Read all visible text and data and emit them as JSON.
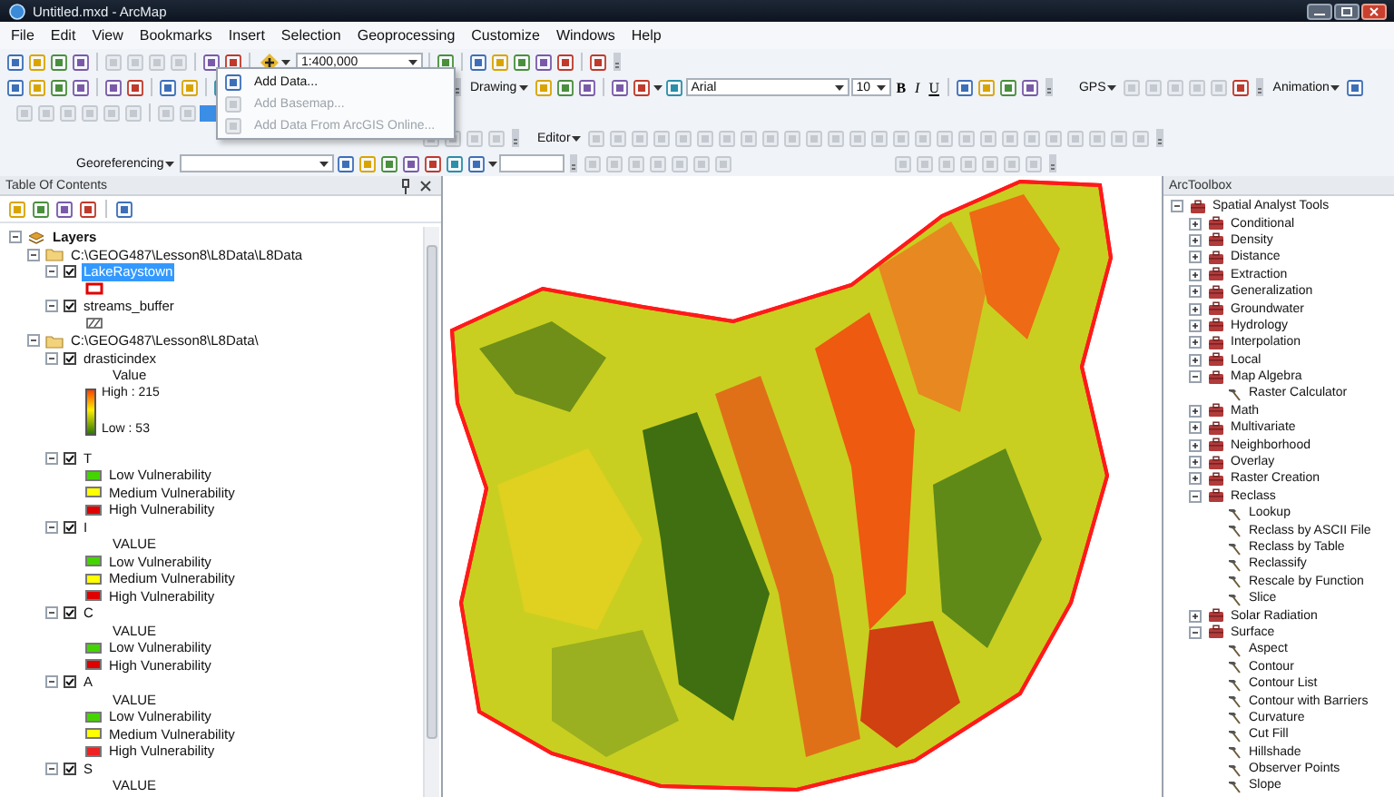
{
  "window": {
    "title": "Untitled.mxd - ArcMap"
  },
  "menu": [
    "File",
    "Edit",
    "View",
    "Bookmarks",
    "Insert",
    "Selection",
    "Geoprocessing",
    "Customize",
    "Windows",
    "Help"
  ],
  "toolbar": {
    "scale": "1:400,000",
    "drawing": "Drawing",
    "font": "Arial",
    "font_size": "10",
    "bold": "B",
    "italic": "I",
    "underline": "U",
    "gps": "GPS",
    "animation": "Animation",
    "editor": "Editor",
    "georeferencing": "Georeferencing"
  },
  "add_data_menu": [
    {
      "label": "Add Data...",
      "disabled": false
    },
    {
      "label": "Add Basemap...",
      "disabled": true
    },
    {
      "label": "Add Data From ArcGIS Online...",
      "disabled": true
    }
  ],
  "toc": {
    "title": "Table Of Contents",
    "root": {
      "label": "Layers",
      "expanded": true,
      "children": [
        {
          "label": "C:\\GEOG487\\Lesson8\\L8Data\\L8Data",
          "expanded": true,
          "children": [
            {
              "name": "LakeRaystown",
              "checked": true,
              "selected": true,
              "expanded": true,
              "legend": [
                {
                  "kind": "outline",
                  "color": "#e00000"
                }
              ]
            },
            {
              "name": "streams_buffer",
              "checked": true,
              "selected": false,
              "expanded": true,
              "legend": [
                {
                  "kind": "hatch"
                }
              ]
            }
          ]
        },
        {
          "label": "C:\\GEOG487\\Lesson8\\L8Data\\",
          "expanded": true,
          "children": [
            {
              "name": "drasticindex",
              "checked": true,
              "selected": false,
              "expanded": true,
              "heading": "Value",
              "ramp": {
                "high": "High : 215",
                "low": "Low : 53"
              }
            },
            {
              "name": "T",
              "checked": true,
              "selected": false,
              "expanded": true,
              "legend": [
                {
                  "kind": "fill",
                  "label": "Low Vulnerability",
                  "color": "#44d400"
                },
                {
                  "kind": "fill",
                  "label": "Medium Vulnerability",
                  "color": "#ffff00"
                },
                {
                  "kind": "fill",
                  "label": "High Vulnerability",
                  "color": "#e00000"
                }
              ]
            },
            {
              "name": "I",
              "checked": true,
              "selected": false,
              "expanded": true,
              "heading": "VALUE",
              "legend": [
                {
                  "kind": "fill",
                  "label": "Low Vulnerability",
                  "color": "#44d400"
                },
                {
                  "kind": "fill",
                  "label": "Medium Vulnerability",
                  "color": "#ffff00"
                },
                {
                  "kind": "fill",
                  "label": "High Vulnerability",
                  "color": "#e00000"
                }
              ]
            },
            {
              "name": "C",
              "checked": true,
              "selected": false,
              "expanded": true,
              "heading": "VALUE",
              "legend": [
                {
                  "kind": "fill",
                  "label": "Low Vulnerability",
                  "color": "#44d400"
                },
                {
                  "kind": "fill",
                  "label": "High Vunerability",
                  "color": "#e00000"
                }
              ]
            },
            {
              "name": "A",
              "checked": true,
              "selected": false,
              "expanded": true,
              "heading": "VALUE",
              "legend": [
                {
                  "kind": "fill",
                  "label": "Low Vulnerability",
                  "color": "#44d400"
                },
                {
                  "kind": "fill",
                  "label": "Medium Vulnerability",
                  "color": "#ffff00"
                },
                {
                  "kind": "fill",
                  "label": "High Vulnerability",
                  "color": "#ee2222"
                }
              ]
            },
            {
              "name": "S",
              "checked": true,
              "selected": false,
              "expanded": true,
              "heading": "VALUE"
            }
          ]
        }
      ]
    }
  },
  "toolbox": {
    "title": "ArcToolbox",
    "items": [
      {
        "label": "Spatial Analyst Tools",
        "kind": "toolbox",
        "expanded": true,
        "children": [
          {
            "label": "Conditional",
            "kind": "toolset",
            "expanded": false
          },
          {
            "label": "Density",
            "kind": "toolset",
            "expanded": false
          },
          {
            "label": "Distance",
            "kind": "toolset",
            "expanded": false
          },
          {
            "label": "Extraction",
            "kind": "toolset",
            "expanded": false
          },
          {
            "label": "Generalization",
            "kind": "toolset",
            "expanded": false
          },
          {
            "label": "Groundwater",
            "kind": "toolset",
            "expanded": false
          },
          {
            "label": "Hydrology",
            "kind": "toolset",
            "expanded": false
          },
          {
            "label": "Interpolation",
            "kind": "toolset",
            "expanded": false
          },
          {
            "label": "Local",
            "kind": "toolset",
            "expanded": false
          },
          {
            "label": "Map Algebra",
            "kind": "toolset",
            "expanded": true,
            "children": [
              {
                "label": "Raster Calculator",
                "kind": "tool"
              }
            ]
          },
          {
            "label": "Math",
            "kind": "toolset",
            "expanded": false
          },
          {
            "label": "Multivariate",
            "kind": "toolset",
            "expanded": false
          },
          {
            "label": "Neighborhood",
            "kind": "toolset",
            "expanded": false
          },
          {
            "label": "Overlay",
            "kind": "toolset",
            "expanded": false
          },
          {
            "label": "Raster Creation",
            "kind": "toolset",
            "expanded": false
          },
          {
            "label": "Reclass",
            "kind": "toolset",
            "expanded": true,
            "children": [
              {
                "label": "Lookup",
                "kind": "tool"
              },
              {
                "label": "Reclass by ASCII File",
                "kind": "tool"
              },
              {
                "label": "Reclass by Table",
                "kind": "tool"
              },
              {
                "label": "Reclassify",
                "kind": "tool"
              },
              {
                "label": "Rescale by Function",
                "kind": "tool"
              },
              {
                "label": "Slice",
                "kind": "tool"
              }
            ]
          },
          {
            "label": "Solar Radiation",
            "kind": "toolset",
            "expanded": false
          },
          {
            "label": "Surface",
            "kind": "toolset",
            "expanded": true,
            "children": [
              {
                "label": "Aspect",
                "kind": "tool"
              },
              {
                "label": "Contour",
                "kind": "tool"
              },
              {
                "label": "Contour List",
                "kind": "tool"
              },
              {
                "label": "Contour with Barriers",
                "kind": "tool"
              },
              {
                "label": "Curvature",
                "kind": "tool"
              },
              {
                "label": "Cut Fill",
                "kind": "tool"
              },
              {
                "label": "Hillshade",
                "kind": "tool"
              },
              {
                "label": "Observer Points",
                "kind": "tool"
              },
              {
                "label": "Slope",
                "kind": "tool"
              }
            ]
          }
        ]
      }
    ]
  }
}
